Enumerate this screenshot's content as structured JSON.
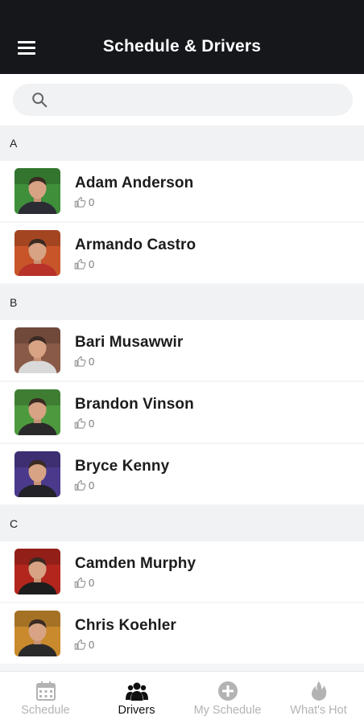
{
  "header": {
    "title": "Schedule & Drivers"
  },
  "search": {
    "placeholder": ""
  },
  "sections": [
    {
      "letter": "A",
      "drivers": [
        {
          "name": "Adam Anderson",
          "likes": "0",
          "avatar_bg": "#3f8f3a",
          "avatar_shirt": "#2c2c34"
        },
        {
          "name": "Armando Castro",
          "likes": "0",
          "avatar_bg": "#c8552a",
          "avatar_shirt": "#b8322a"
        }
      ]
    },
    {
      "letter": "B",
      "drivers": [
        {
          "name": "Bari Musawwir",
          "likes": "0",
          "avatar_bg": "#8a5a48",
          "avatar_shirt": "#d9d9d9"
        },
        {
          "name": "Brandon Vinson",
          "likes": "0",
          "avatar_bg": "#4d9a3e",
          "avatar_shirt": "#2a2a2a"
        },
        {
          "name": "Bryce Kenny",
          "likes": "0",
          "avatar_bg": "#4b3a8c",
          "avatar_shirt": "#222228"
        }
      ]
    },
    {
      "letter": "C",
      "drivers": [
        {
          "name": "Camden Murphy",
          "likes": "0",
          "avatar_bg": "#b3261e",
          "avatar_shirt": "#1d1d1d"
        },
        {
          "name": "Chris Koehler",
          "likes": "0",
          "avatar_bg": "#c98a2e",
          "avatar_shirt": "#2a2a2a"
        }
      ]
    }
  ],
  "nav": [
    {
      "label": "Schedule",
      "icon": "calendar-icon",
      "active": false
    },
    {
      "label": "Drivers",
      "icon": "people-icon",
      "active": true
    },
    {
      "label": "My Schedule",
      "icon": "plus-circle-icon",
      "active": false
    },
    {
      "label": "What's Hot",
      "icon": "flame-icon",
      "active": false
    }
  ],
  "colors": {
    "header_bg": "#15171b",
    "section_bg": "#f1f2f3",
    "nav_active": "#111111",
    "nav_inactive": "#b3b3b3"
  }
}
